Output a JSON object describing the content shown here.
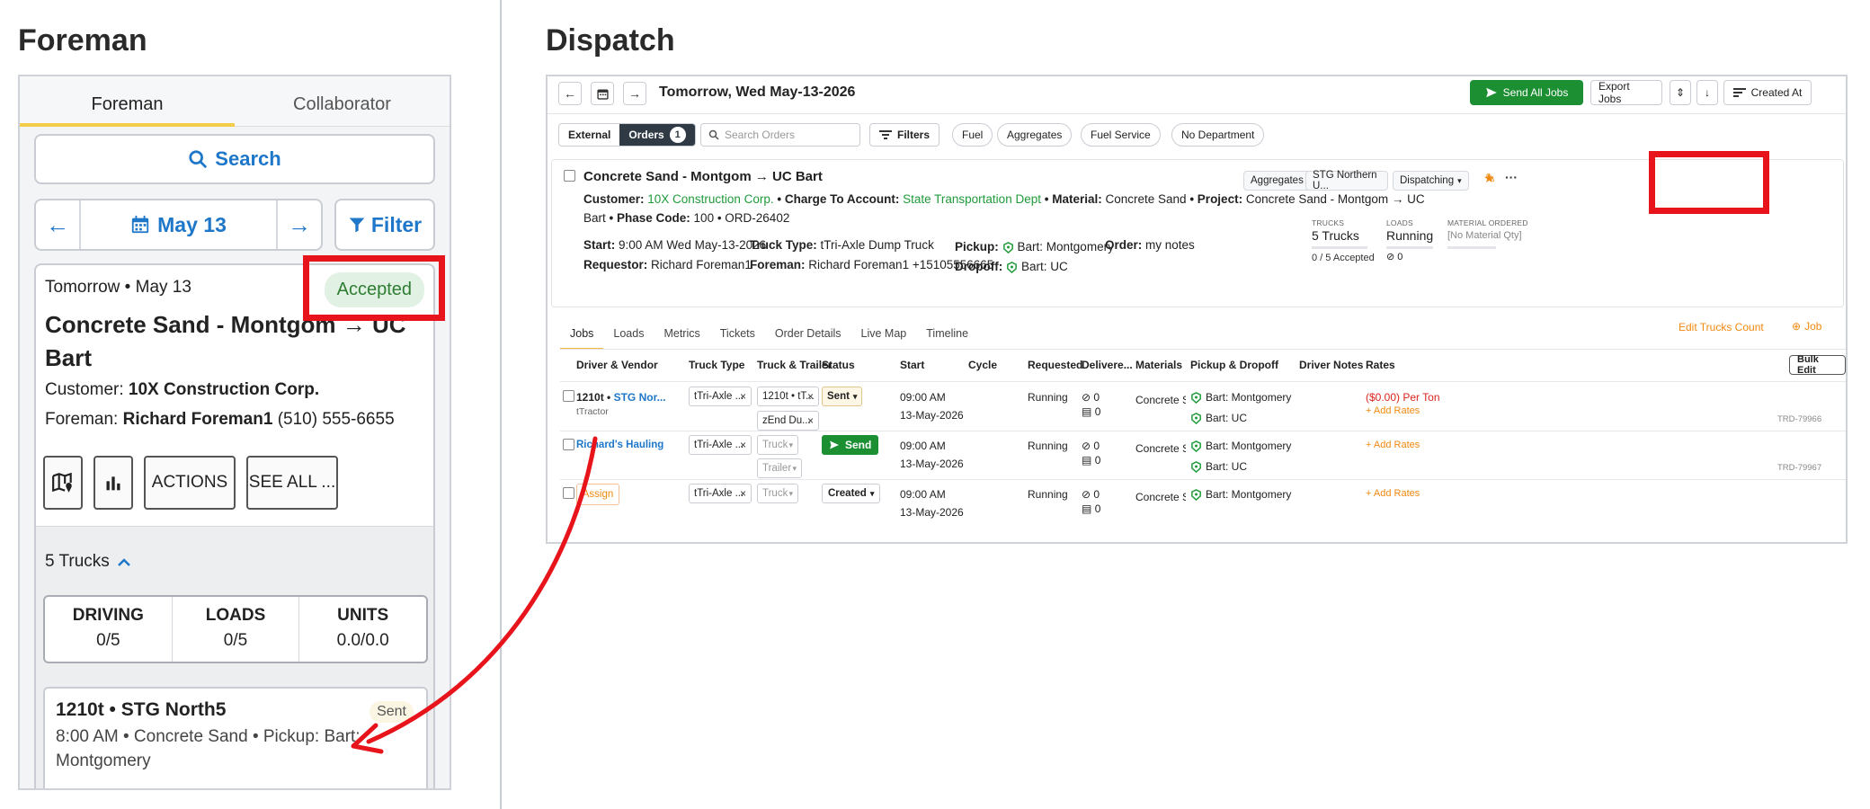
{
  "colors": {
    "accent_blue": "#1e77c9",
    "success_green": "#1c8f33",
    "highlight_red": "#e8141b",
    "tab_yellow": "#f3cd4a",
    "link_orange": "#f0890f"
  },
  "foreman": {
    "section_title": "Foreman",
    "tabs": [
      "Foreman",
      "Collaborator"
    ],
    "search_label": "Search",
    "date_label": "May 13",
    "filter_label": "Filter",
    "card": {
      "when": "Tomorrow • May 13",
      "status": "Accepted",
      "title": "Concrete Sand - Montgom → UC Bart",
      "customer_label": "Customer:",
      "customer": "10X Construction Corp.",
      "foreman_label": "Foreman:",
      "foreman": "Richard Foreman1",
      "foreman_phone": "(510) 555-6655",
      "actions_label": "ACTIONS",
      "see_all_label": "SEE ALL ..."
    },
    "trucks_label": "5 Trucks",
    "stats": [
      {
        "label": "DRIVING",
        "value": "0/5"
      },
      {
        "label": "LOADS",
        "value": "0/5"
      },
      {
        "label": "UNITS",
        "value": "0.0/0.0"
      }
    ],
    "truck_card": {
      "title": "1210t • STG North5",
      "status": "Sent",
      "detail": "8:00 AM • Concrete Sand • Pickup: Bart: Montgomery"
    }
  },
  "dispatch": {
    "section_title": "Dispatch",
    "date": "Tomorrow, Wed May-13-2026",
    "send_all_label": "Send All Jobs",
    "export_label": "Export Jobs",
    "sort_label": "Created At",
    "seg": {
      "external": "External",
      "orders": "Orders",
      "orders_count": "1"
    },
    "search_placeholder": "Search Orders",
    "filters_label": "Filters",
    "pills": [
      "Fuel",
      "Aggregates",
      "Fuel Service",
      "No Department"
    ],
    "order": {
      "title": "Concrete Sand - Montgom → UC Bart",
      "customer_label": "Customer:",
      "customer": "10X Construction Corp.",
      "charge_label": "• Charge To Account:",
      "charge": "State Transportation Dept",
      "material_label": "• Material:",
      "material": "Concrete Sand",
      "project_label": "• Project:",
      "project": "Concrete Sand - Montgom → UC Bart",
      "phase_label": "• Phase Code:",
      "phase": "100 • ORD-26402",
      "start_label": "Start:",
      "start": "9:00 AM Wed May-13-2026",
      "requestor_label": "Requestor:",
      "requestor": "Richard Foreman1",
      "truck_type_label": "Truck Type:",
      "truck_type": "tTri-Axle Dump Truck",
      "foreman_label": "Foreman:",
      "foreman": "Richard Foreman1 +15105556665",
      "pickup_label": "Pickup:",
      "pickup": "Bart: Montgomery",
      "dropoff_label": "Dropoff:",
      "dropoff": "Bart: UC",
      "order_label": "Order:",
      "order_notes": "my notes",
      "tag_aggregates": "Aggregates",
      "tag_vendor": "STG Northern U...",
      "tag_status": "Dispatching",
      "trucks_label": "TRUCKS",
      "trucks_value": "5 Trucks",
      "trucks_accepted": "0 / 5 Accepted",
      "loads_label": "LOADS",
      "loads_value": "Running",
      "loads_count": "0",
      "material_ordered_label": "MATERIAL ORDERED",
      "material_ordered_value": "[No Material Qty]"
    },
    "tabs": [
      "Jobs",
      "Loads",
      "Metrics",
      "Tickets",
      "Order Details",
      "Live Map",
      "Timeline"
    ],
    "edit_trucks_label": "Edit Trucks Count",
    "add_job_label": "Job",
    "columns": [
      "Driver & Vendor",
      "Truck Type",
      "Truck & Trailer",
      "Status",
      "Start",
      "Cycle",
      "Requested",
      "Delivere...",
      "Materials",
      "Pickup & Dropoff",
      "Driver Notes",
      "Rates"
    ],
    "bulk_edit_label": "Bulk Edit",
    "rows": [
      {
        "driver": "1210t •",
        "vendor": "STG Nor...",
        "sub": "tTractor",
        "truck_type": "tTri-Axle ...",
        "truck": "1210t • tT...",
        "trailer": "zEnd Du...",
        "status": "Sent",
        "start_time": "09:00 AM",
        "start_date": "13-May-2026",
        "requested": "Running",
        "delivered_a": "0",
        "delivered_b": "0",
        "material": "Concrete Sar",
        "pickup": "Bart: Montgomery",
        "dropoff": "Bart: UC",
        "rate": "($0.00) Per Ton",
        "add_rates": "+ Add Rates",
        "ref": "TRD-79966"
      },
      {
        "driver": "",
        "vendor": "Richard's Hauling",
        "sub": "",
        "truck_type": "tTri-Axle ...",
        "truck": "Truck",
        "trailer": "Trailer",
        "status": "Send",
        "start_time": "09:00 AM",
        "start_date": "13-May-2026",
        "requested": "Running",
        "delivered_a": "0",
        "delivered_b": "0",
        "material": "Concrete Sar",
        "pickup": "Bart: Montgomery",
        "dropoff": "Bart: UC",
        "rate": "",
        "add_rates": "+ Add Rates",
        "ref": "TRD-79967"
      },
      {
        "driver": "",
        "vendor": "Assign",
        "sub": "",
        "truck_type": "tTri-Axle ...",
        "truck": "Truck",
        "trailer": "",
        "status": "Created",
        "start_time": "09:00 AM",
        "start_date": "13-May-2026",
        "requested": "Running",
        "delivered_a": "0",
        "delivered_b": "0",
        "material": "Concrete Sar",
        "pickup": "Bart: Montgomery",
        "dropoff": "",
        "rate": "",
        "add_rates": "+ Add Rates",
        "ref": ""
      }
    ]
  }
}
